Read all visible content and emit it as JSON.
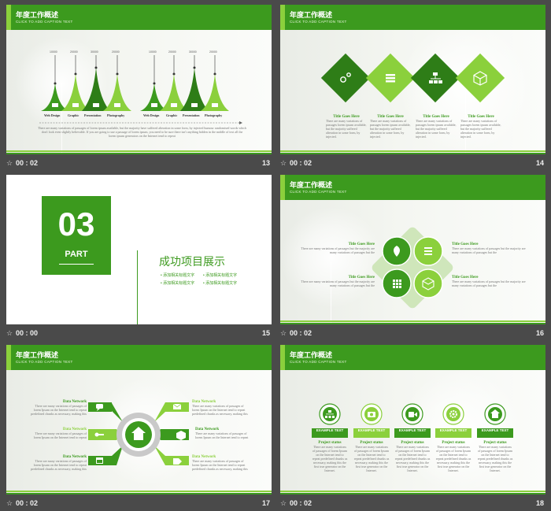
{
  "header": {
    "title": "年度工作概述",
    "subtitle": "CLICK TO ADD CAPTION TEXT"
  },
  "slides": [
    {
      "num": "13",
      "time": "00 : 02",
      "value_labels": [
        "10000",
        "20000",
        "30000",
        "20000",
        "10000",
        "20000",
        "30000",
        "20000"
      ],
      "categories": [
        "Web Design",
        "Graphic",
        "Presentation",
        "Photography",
        "Web Design",
        "Graphic",
        "Presentation",
        "Photography"
      ],
      "body": "There are many variations of passages of lorem ipsum available, but the majority have suffered alteration in some form, by injected humour randomised words which don't look even slightly believable. If you are going to use a passage of lorem ipsum, you need to be sure there isn't anything hidden in the middle of text all the lorem ipsum generators on the Internet tend to repeat"
    },
    {
      "num": "14",
      "time": "00 : 02",
      "items": [
        {
          "title": "Title Goes Here",
          "body": "There are many variations of passages lorem ipsum available, but the majority suffered alteration in some form, by injected."
        },
        {
          "title": "Title Goes Here",
          "body": "There are many variations of passages lorem ipsum available, but the majority suffered alteration in some form, by injected."
        },
        {
          "title": "Title Goes Here",
          "body": "There are many variations of passages lorem ipsum available, but the majority suffered alteration in some form, by injected."
        },
        {
          "title": "Title Goes Here",
          "body": "There are many variations of passages lorem ipsum available, but the majority suffered alteration in some form, by injected."
        }
      ]
    },
    {
      "num": "15",
      "time": "00 : 00",
      "section_num": "03",
      "section_label": "PART",
      "section_title": "成功项目展示",
      "bullets": [
        "添加相关标题文字",
        "添加相关标题文字",
        "添加相关标题文字",
        "添加相关标题文字"
      ]
    },
    {
      "num": "16",
      "time": "00 : 02",
      "items": [
        {
          "title": "Title Goes Here",
          "body": "There are many variations of passages but the majority are many variations of passages but the"
        },
        {
          "title": "Title Goes Here",
          "body": "There are many variations of passages but the majority are many variations of passages but the"
        },
        {
          "title": "Title Goes Here",
          "body": "There are many variations of passages but the majority are many variations of passages but the"
        },
        {
          "title": "Title Goes Here",
          "body": "There are many variations of passages but the majority are many variations of passages but the"
        }
      ]
    },
    {
      "num": "17",
      "time": "00 : 02",
      "items": [
        {
          "title": "Data Network",
          "body": "There are many variations of passages of lorem Ipsum on the Internet tend to repeat predefined chunks as necessary, making this"
        },
        {
          "title": "Data Network",
          "body": "There are many variations of passages of lorem Ipsum on the Internet tend to repeat"
        },
        {
          "title": "Data Network",
          "body": "There are many variations of passages of lorem Ipsum on the Internet tend to repeat predefined chunks as necessary, making this"
        },
        {
          "title": "Data Network",
          "body": "There are many variations of passages of lorem Ipsum on the Internet tend to repeat predefined chunks as necessary, making this"
        },
        {
          "title": "Data Network",
          "body": "There are many variations of passages of lorem Ipsum on the Internet tend to repeat"
        },
        {
          "title": "Data Network",
          "body": "There are many variations of passages of lorem Ipsum on the Internet tend to repeat predefined chunks as necessary, making this"
        }
      ]
    },
    {
      "num": "18",
      "time": "00 : 02",
      "items": [
        {
          "tag": "EXAMPLE TEXT",
          "title": "Project status",
          "body": "There are many variations of passages of lorem Ipsum on the Internet tend to repeat predefined chunks as necessary, making this the first true generator on the Internet."
        },
        {
          "tag": "EXAMPLE TEXT",
          "title": "Project status",
          "body": "There are many variations of passages of lorem Ipsum on the Internet tend to repeat predefined chunks as necessary, making this the first true generator on the Internet."
        },
        {
          "tag": "EXAMPLE TEXT",
          "title": "Project status",
          "body": "There are many variations of passages of lorem Ipsum on the Internet tend to repeat predefined chunks as necessary, making this the first true generator on the Internet."
        },
        {
          "tag": "EXAMPLE TEXT",
          "title": "Project status",
          "body": "There are many variations of passages of lorem Ipsum on the Internet tend to repeat predefined chunks as necessary, making this the first true generator on the Internet."
        },
        {
          "tag": "EXAMPLE TEXT",
          "title": "Project status",
          "body": "There are many variations of passages of lorem Ipsum on the Internet tend to repeat predefined chunks as necessary, making this the first true generator on the Internet."
        }
      ]
    }
  ],
  "icons": {
    "star": "star-icon",
    "gears": "gears-icon",
    "list": "list-icon",
    "org": "org-chart-icon",
    "cube": "cube-icon",
    "leaf": "leaf-icon",
    "grid": "grid-icon",
    "chat": "chat-icon",
    "key": "key-icon",
    "calendar": "calendar-icon",
    "mail": "mail-icon",
    "box": "box-icon",
    "tag": "tag-icon",
    "home": "home-icon",
    "camera": "camera-icon",
    "video": "video-icon",
    "settings": "settings-icon"
  },
  "colors": {
    "dark_green": "#3c9a1e",
    "light_green": "#8bd03c",
    "deep_green": "#2e7d17"
  }
}
